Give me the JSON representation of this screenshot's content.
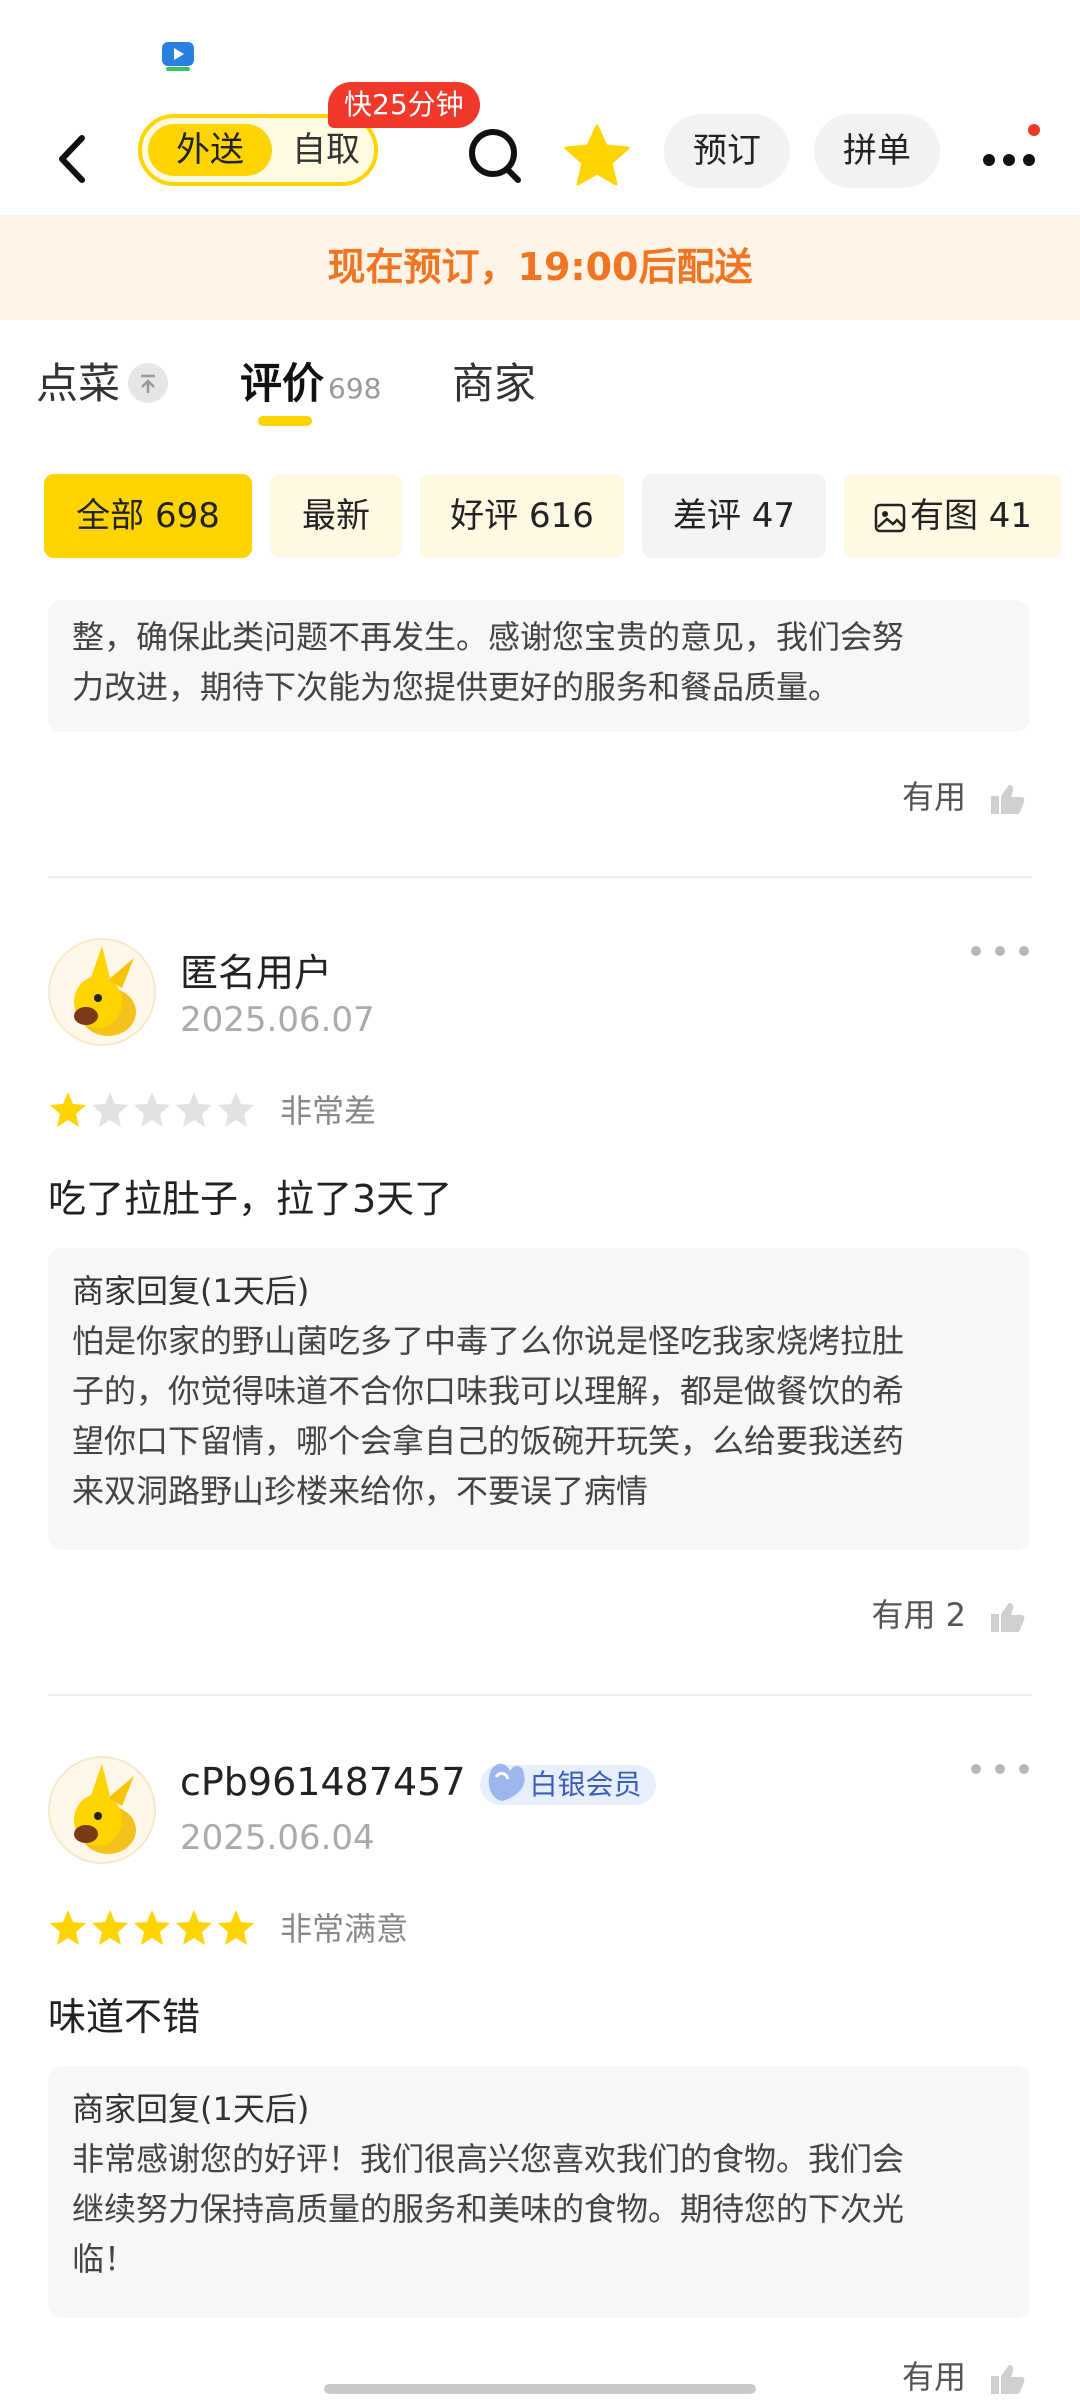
{
  "topbar": {
    "mode_delivery": "外送",
    "mode_pickup": "自取",
    "speed_badge": "快25分钟",
    "reserve_label": "预订",
    "group_label": "拼单"
  },
  "notice": "现在预订，19:00后配送",
  "tabs": [
    {
      "label": "点菜"
    },
    {
      "label": "评价",
      "count": "698"
    },
    {
      "label": "商家"
    }
  ],
  "filters": [
    {
      "label": "全部 698"
    },
    {
      "label": "最新"
    },
    {
      "label": "好评 616"
    },
    {
      "label": "差评 47"
    },
    {
      "label": "有图 41"
    }
  ],
  "prev_reply": {
    "text_line1": "整，确保此类问题不再发生。感谢您宝贵的意见，我们会努",
    "text_line2": "力改进，期待下次能为您提供更好的服务和餐品质量。",
    "useful": "有用"
  },
  "reviews": [
    {
      "user": "匿名用户",
      "date": "2025.06.07",
      "rating": 1,
      "rating_text": "非常差",
      "text": "吃了拉肚子，拉了3天了",
      "reply_title": "商家回复(1天后)",
      "reply_lines": [
        "怕是你家的野山菌吃多了中毒了么你说是怪吃我家烧烤拉肚",
        "子的，你觉得味道不合你口味我可以理解，都是做餐饮的希",
        "望你口下留情，哪个会拿自己的饭碗开玩笑，么给要我送药",
        "来双洞路野山珍楼来给你，不要误了病情"
      ],
      "useful": "有用 2"
    },
    {
      "user": "cPb961487457",
      "badge": "白银会员",
      "date": "2025.06.04",
      "rating": 5,
      "rating_text": "非常满意",
      "text": "味道不错",
      "reply_title": "商家回复(1天后)",
      "reply_lines": [
        "非常感谢您的好评！我们很高兴您喜欢我们的食物。我们会",
        "继续努力保持高质量的服务和美味的食物。期待您的下次光",
        "临！"
      ],
      "useful": "有用"
    }
  ],
  "colors": {
    "accent": "#ffd400",
    "notice_text": "#f07522",
    "badge_red": "#f0392a"
  },
  "icons": [
    "back-icon",
    "search-icon",
    "star-favorite-icon",
    "more-icon",
    "thumb-up-icon",
    "image-icon",
    "pin-top-icon"
  ]
}
